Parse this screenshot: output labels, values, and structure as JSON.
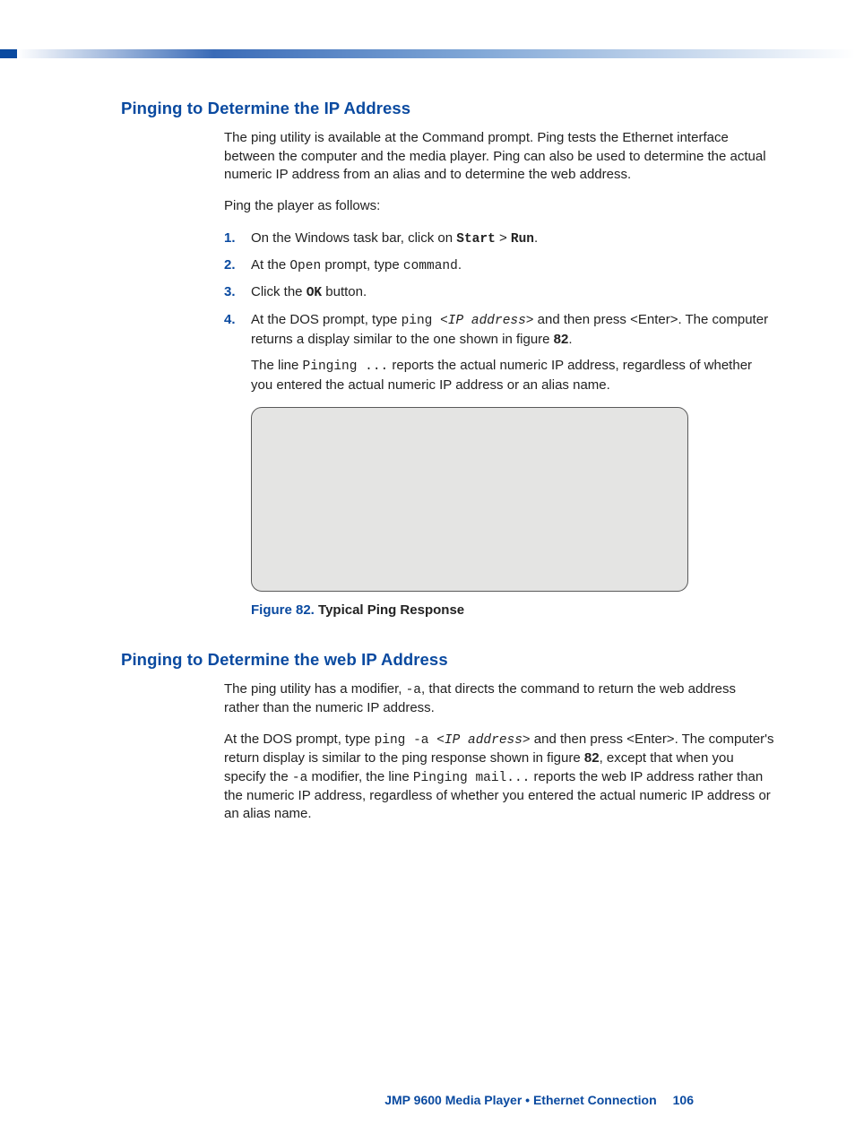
{
  "section1": {
    "heading": "Pinging to Determine the IP Address",
    "intro": "The ping utility is available at the Command prompt. Ping tests the Ethernet interface between the computer and the media player. Ping can also be used to determine the actual numeric IP address from an alias and to determine the web address.",
    "lead": "Ping the player as follows:",
    "steps": {
      "s1a": "On the Windows task bar, click on ",
      "s1b": "Start",
      "s1c": " > ",
      "s1d": "Run",
      "s1e": ".",
      "s2a": "At the ",
      "s2b": "Open",
      "s2c": " prompt, type ",
      "s2d": "command",
      "s2e": ".",
      "s3a": "Click the ",
      "s3b": "OK",
      "s3c": " button.",
      "s4a": "At the DOS prompt, type ",
      "s4b": "ping ",
      "s4c": "<IP address>",
      "s4d": " and then press <Enter>. The computer returns a display similar to the one shown in figure ",
      "s4e": "82",
      "s4f": ".",
      "s4sub_a": "The line ",
      "s4sub_b": "Pinging ...",
      "s4sub_c": " reports the actual numeric IP address, regardless of whether you entered the actual numeric IP address or an alias name."
    },
    "figure": {
      "label": "Figure 82.",
      "title": " Typical Ping Response"
    }
  },
  "section2": {
    "heading": "Pinging to Determine the web IP Address",
    "p1a": "The ping utility has a modifier, ",
    "p1b": "-a",
    "p1c": ", that directs the command to return the web address rather than the numeric IP address.",
    "p2a": "At the DOS prompt, type ",
    "p2b": "ping -a ",
    "p2c": "<IP address>",
    "p2d": " and then press <Enter>. The computer's return display is similar to the ping response shown in figure ",
    "p2e": "82",
    "p2f": ", except that when you specify the ",
    "p2g": "-a",
    "p2h": " modifier, the line ",
    "p2i": "Pinging mail...",
    "p2j": " reports the web IP address rather than the numeric IP address, regardless of whether you entered the actual numeric IP address or an alias name."
  },
  "footer": {
    "text": "JMP 9600 Media Player • Ethernet Connection",
    "page": "106"
  }
}
